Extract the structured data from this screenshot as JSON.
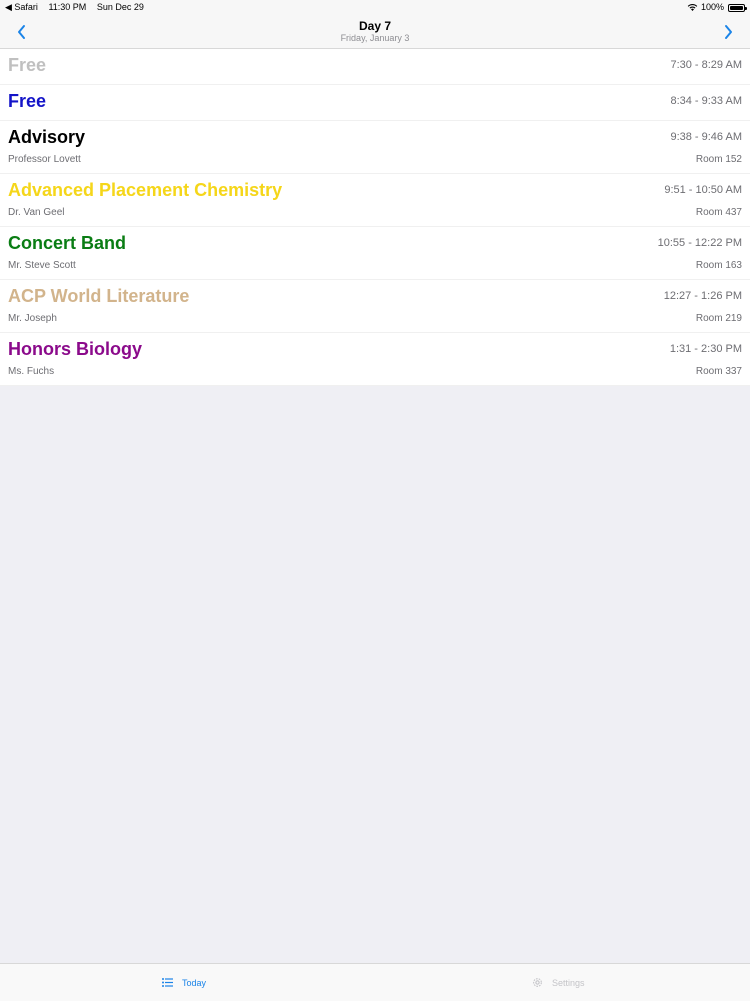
{
  "status_bar": {
    "back_app": "◀ Safari",
    "time": "11:30 PM",
    "date": "Sun Dec 29",
    "battery": "100%"
  },
  "header": {
    "title": "Day 7",
    "subtitle": "Friday, January 3"
  },
  "periods": [
    {
      "name": "Free",
      "time": "7:30 - 8:29 AM",
      "teacher": "",
      "room": "",
      "color": "#c0c0c0"
    },
    {
      "name": "Free",
      "time": "8:34 - 9:33 AM",
      "teacher": "",
      "room": "",
      "color": "#1414c8"
    },
    {
      "name": "Advisory",
      "time": "9:38 - 9:46 AM",
      "teacher": "Professor Lovett",
      "room": "Room 152",
      "color": "#000000"
    },
    {
      "name": "Advanced Placement Chemistry",
      "time": "9:51 - 10:50 AM",
      "teacher": "Dr. Van Geel",
      "room": "Room 437",
      "color": "#f5d61a"
    },
    {
      "name": "Concert Band",
      "time": "10:55 - 12:22 PM",
      "teacher": "Mr. Steve Scott",
      "room": "Room 163",
      "color": "#0a7d14"
    },
    {
      "name": "ACP World Literature",
      "time": "12:27 - 1:26 PM",
      "teacher": "Mr. Joseph",
      "room": "Room 219",
      "color": "#d2b48c"
    },
    {
      "name": "Honors Biology",
      "time": "1:31 - 2:30 PM",
      "teacher": "Ms. Fuchs",
      "room": "Room 337",
      "color": "#8b0a8b"
    }
  ],
  "tabs": {
    "today": {
      "label": "Today",
      "icon": "list-icon",
      "color": "#1b84e8"
    },
    "settings": {
      "label": "Settings",
      "icon": "gear-icon",
      "color": "#c4c4c8"
    }
  },
  "colors": {
    "accent": "#1b84e8",
    "background": "#efeff4"
  }
}
